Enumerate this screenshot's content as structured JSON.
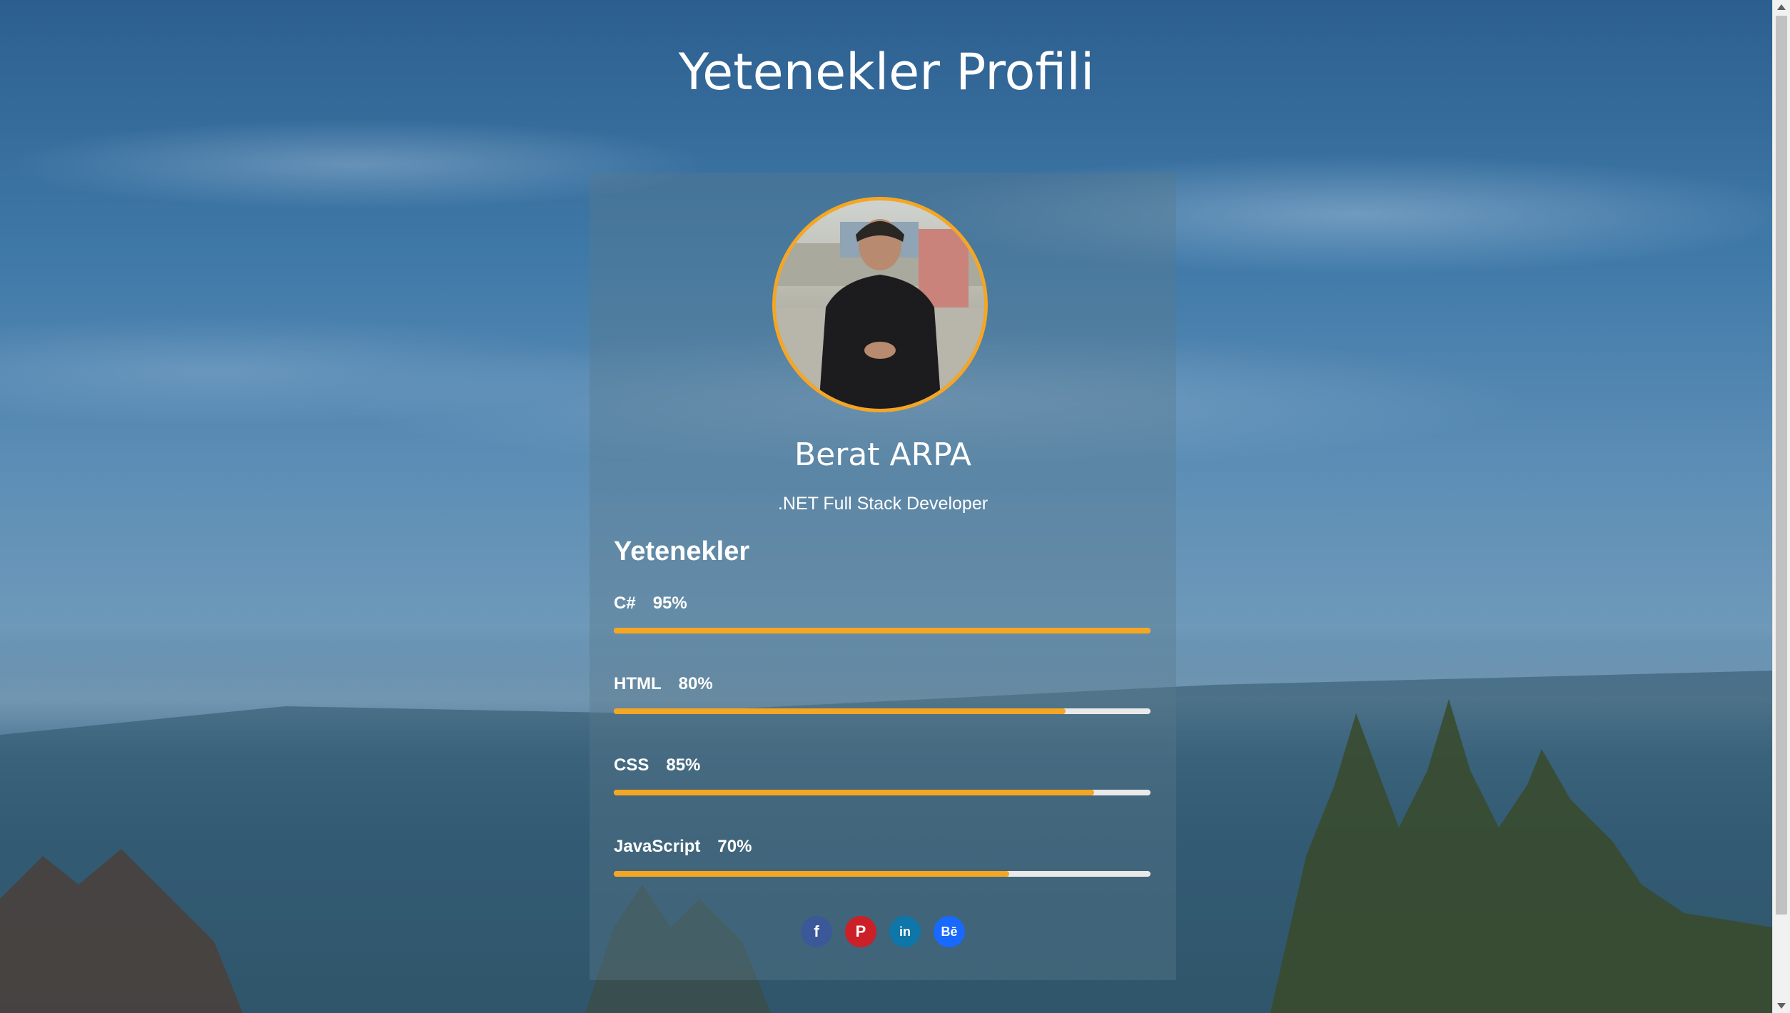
{
  "page": {
    "title": "Yetenekler Profili"
  },
  "profile": {
    "name": "Berat ARPA",
    "role": ".NET Full Stack Developer",
    "avatar_border_color": "#f5a623"
  },
  "skills": {
    "heading": "Yetenekler",
    "bar_color": "#f5a623",
    "items": [
      {
        "name": "C#",
        "percent_label": "95%",
        "level": 1.0
      },
      {
        "name": "HTML",
        "percent_label": "80%",
        "level": 0.842
      },
      {
        "name": "CSS",
        "percent_label": "85%",
        "level": 0.895
      },
      {
        "name": "JavaScript",
        "percent_label": "70%",
        "level": 0.737
      }
    ]
  },
  "socials": [
    {
      "name": "facebook",
      "icon": "facebook-icon",
      "glyph": "f",
      "color": "#3b5998"
    },
    {
      "name": "pinterest",
      "icon": "pinterest-icon",
      "glyph": "P",
      "color": "#cb2027"
    },
    {
      "name": "linkedin",
      "icon": "linkedin-icon",
      "glyph": "in",
      "color": "#0e76a8"
    },
    {
      "name": "behance",
      "icon": "behance-icon",
      "glyph": "Bē",
      "color": "#1769ff"
    }
  ]
}
